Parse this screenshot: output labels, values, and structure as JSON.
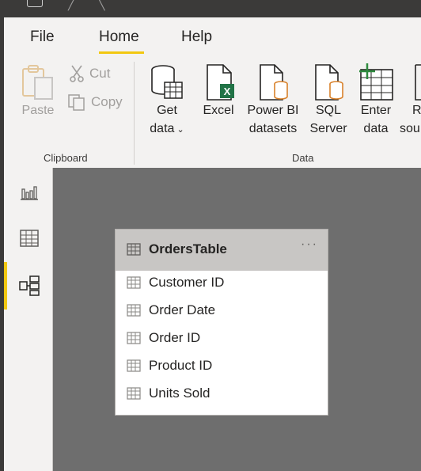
{
  "ribbon": {
    "menu": [
      "File",
      "Home",
      "Help"
    ],
    "active_menu": "Home",
    "clipboard": {
      "paste": "Paste",
      "cut": "Cut",
      "copy": "Copy",
      "group_label": "Clipboard"
    },
    "data_group": {
      "get_data": [
        "Get",
        "data"
      ],
      "excel": "Excel",
      "power_bi": [
        "Power BI",
        "datasets"
      ],
      "sql_server": [
        "SQL",
        "Server"
      ],
      "enter_data": [
        "Enter",
        "data"
      ],
      "recent_sources": [
        "Re",
        "sou"
      ],
      "group_label": "Data"
    },
    "accent_color": "#f2c811"
  },
  "left_nav": {
    "items": [
      "report-view-icon",
      "data-view-icon",
      "model-view-icon"
    ],
    "active": "model-view-icon"
  },
  "table_card": {
    "title": "OrdersTable",
    "more": "···",
    "fields": [
      "Customer ID",
      "Order Date",
      "Order ID",
      "Product ID",
      "Units Sold"
    ]
  }
}
